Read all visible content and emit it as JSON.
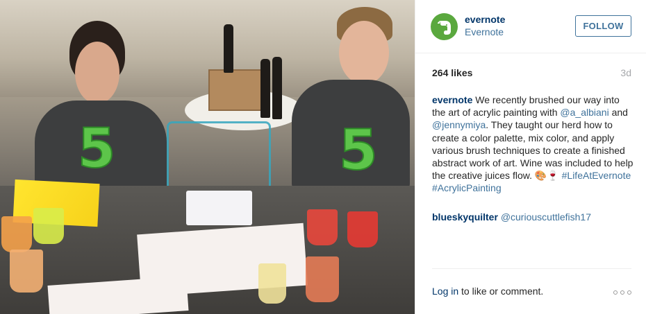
{
  "post": {
    "image_alt": "People painting with acrylics wearing Evernote 5 shirts",
    "shirt_digit_left": "5",
    "shirt_digit_right": "5"
  },
  "header": {
    "username": "evernote",
    "full_name": "Evernote",
    "follow_label": "FOLLOW",
    "avatar_icon": "evernote-elephant-icon"
  },
  "stats": {
    "likes": "264 likes",
    "time_ago": "3d"
  },
  "caption": {
    "username": "evernote",
    "text_1": " We recently brushed our way into the art of acrylic painting with ",
    "mention_1": "@a_albiani",
    "text_2": " and ",
    "mention_2": "@jennymiya",
    "text_3": ". They taught our herd how to create a color palette, mix color, and apply various brush techniques to create a finished abstract work of art. Wine was included to help the creative juices flow. ",
    "emoji": "🎨🍷",
    "hashtag_1": "#LifeAtEvernote",
    "hashtag_2": "#AcrylicPainting"
  },
  "comment": {
    "username": "blueskyquilter",
    "mention": "@curiouscuttlefish17"
  },
  "footer": {
    "login_link": "Log in",
    "login_suffix": " to like or comment.",
    "more_icon": "more-options-icon"
  },
  "colors": {
    "link_dark": "#003569",
    "link": "#3f729b",
    "muted": "#a5a7aa",
    "evernote_green": "#5aa83e"
  }
}
